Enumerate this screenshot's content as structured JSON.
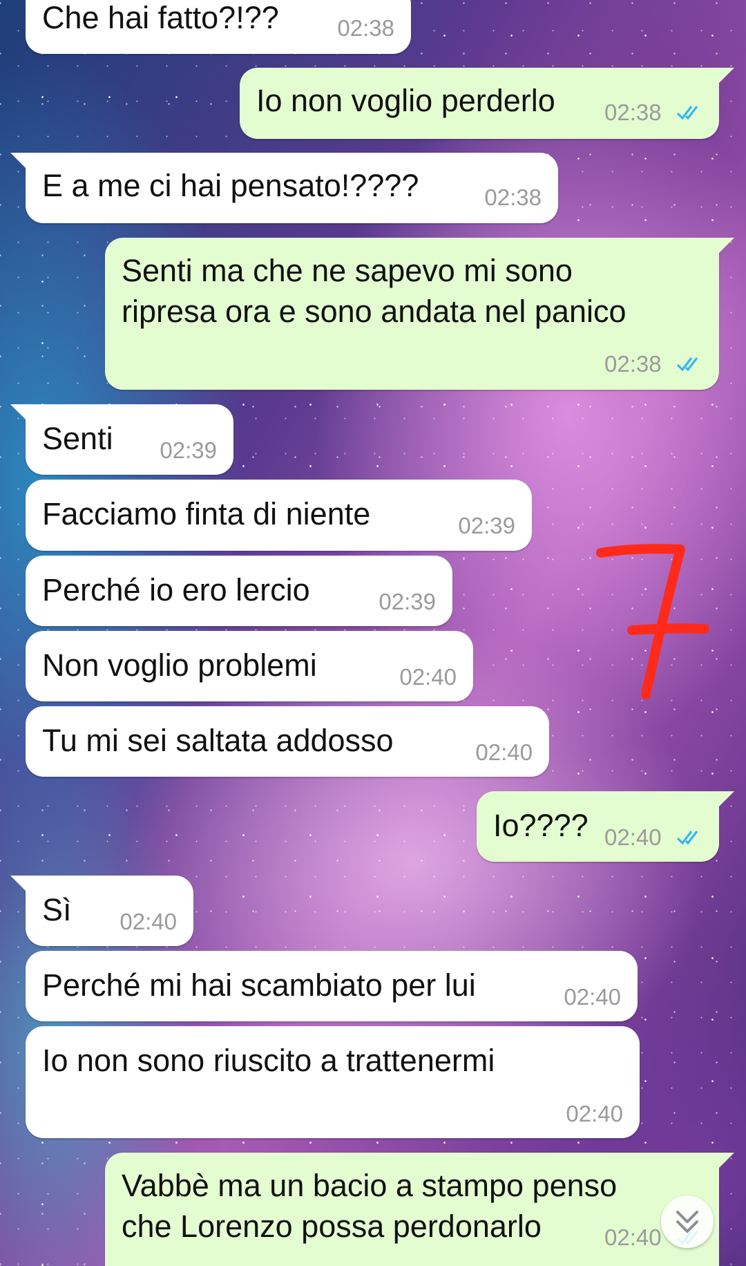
{
  "messages": [
    {
      "side": "in",
      "lines": [
        "Che hai fatto?!??"
      ],
      "time": "02:38",
      "read": false
    },
    {
      "side": "out",
      "lines": [
        "Io non voglio perderlo"
      ],
      "time": "02:38",
      "read": true
    },
    {
      "side": "in",
      "lines": [
        "E a me ci hai pensato!????"
      ],
      "time": "02:38",
      "read": false
    },
    {
      "side": "out",
      "lines": [
        "Senti ma che ne sapevo mi sono",
        "ripresa ora e sono andata nel panico"
      ],
      "time": "02:38",
      "read": true
    },
    {
      "side": "in",
      "lines": [
        "Senti"
      ],
      "time": "02:39",
      "read": false
    },
    {
      "side": "in",
      "lines": [
        "Facciamo finta di niente"
      ],
      "time": "02:39",
      "read": false
    },
    {
      "side": "in",
      "lines": [
        "Perché io ero lercio"
      ],
      "time": "02:39",
      "read": false
    },
    {
      "side": "in",
      "lines": [
        "Non voglio problemi"
      ],
      "time": "02:40",
      "read": false
    },
    {
      "side": "in",
      "lines": [
        "Tu mi sei saltata addosso"
      ],
      "time": "02:40",
      "read": false
    },
    {
      "side": "out",
      "lines": [
        "Io????"
      ],
      "time": "02:40",
      "read": true
    },
    {
      "side": "in",
      "lines": [
        "Sì"
      ],
      "time": "02:40",
      "read": false
    },
    {
      "side": "in",
      "lines": [
        "Perché mi hai scambiato per lui"
      ],
      "time": "02:40",
      "read": false
    },
    {
      "side": "in",
      "lines": [
        "Io non sono riuscito a trattenermi"
      ],
      "time": "02:40",
      "read": false
    },
    {
      "side": "out",
      "lines": [
        "Vabbè ma un bacio a stampo penso",
        "che Lorenzo possa perdonarlo"
      ],
      "time": "02:40",
      "read": true
    }
  ],
  "annotation": {
    "text": "7",
    "color": "#ff2a1a"
  },
  "colors": {
    "incoming": "#ffffff",
    "outgoing": "#e3fdd1",
    "tick_blue": "#34b7f1",
    "time_gray": "#9a9a9a"
  },
  "icons": {
    "read_receipt": "double-check-icon",
    "scroll_down": "double-chevron-down-icon"
  }
}
